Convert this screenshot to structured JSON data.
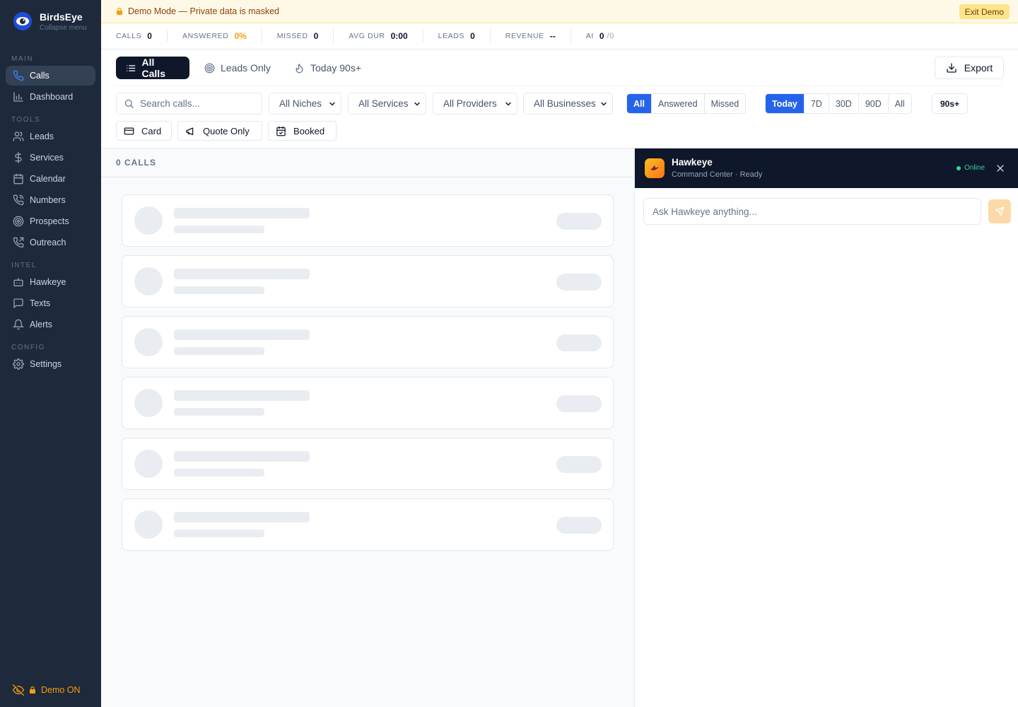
{
  "sidebar": {
    "brand": {
      "name": "BirdsEye",
      "sub": "Collapse menu"
    },
    "sections": {
      "main": "MAIN",
      "tools": "TOOLS",
      "intel": "INTEL",
      "config": "CONFIG"
    },
    "items": [
      {
        "label": "Calls",
        "icon": "phone-icon",
        "active": true
      },
      {
        "label": "Dashboard",
        "icon": "bar-chart-icon"
      },
      {
        "label": "Leads",
        "icon": "users-icon"
      },
      {
        "label": "Services",
        "icon": "dollar-icon"
      },
      {
        "label": "Calendar",
        "icon": "calendar-icon"
      },
      {
        "label": "Numbers",
        "icon": "phone-call-icon"
      },
      {
        "label": "Prospects",
        "icon": "target-icon"
      },
      {
        "label": "Outreach",
        "icon": "phone-outgoing-icon"
      },
      {
        "label": "Hawkeye",
        "icon": "bot-icon"
      },
      {
        "label": "Texts",
        "icon": "message-icon"
      },
      {
        "label": "Alerts",
        "icon": "bell-icon"
      },
      {
        "label": "Settings",
        "icon": "gear-icon"
      }
    ],
    "demo_toggle": "Demo ON"
  },
  "banner": {
    "text": "Demo Mode — Private data is masked",
    "exit_label": "Exit Demo"
  },
  "stats": [
    {
      "label": "CALLS",
      "value": "0"
    },
    {
      "label": "ANSWERED",
      "value": "0%"
    },
    {
      "label": "MISSED",
      "value": "0"
    },
    {
      "label": "AVG DUR",
      "value": "0:00"
    },
    {
      "label": "LEADS",
      "value": "0"
    },
    {
      "label": "REVENUE",
      "value": "--"
    },
    {
      "label": "AI",
      "value": "0",
      "suffix": "/0"
    }
  ],
  "view_tabs": [
    {
      "label": "All Calls",
      "icon": "list-icon",
      "active": true
    },
    {
      "label": "Leads Only",
      "icon": "target-icon"
    },
    {
      "label": "Today 90s+",
      "icon": "flame-icon"
    }
  ],
  "export_label": "Export",
  "search": {
    "placeholder": "Search calls..."
  },
  "filters": {
    "niches": "All Niches",
    "services": "All Services",
    "providers": "All Providers",
    "businesses": "All Businesses"
  },
  "status_seg": {
    "options": [
      "All",
      "Answered",
      "Missed"
    ],
    "selected": "All"
  },
  "range_seg": {
    "options": [
      "Today",
      "7D",
      "30D",
      "90D",
      "All"
    ],
    "selected": "Today"
  },
  "duration_chip": "90s+",
  "tags": [
    "Card",
    "Quote Only",
    "Booked"
  ],
  "list": {
    "count_label": "0 CALLS",
    "skeleton_rows": 6
  },
  "hawkeye": {
    "name": "Hawkeye",
    "subtitle": "Command Center · Ready",
    "status": "Online",
    "input_placeholder": "Ask Hawkeye anything..."
  },
  "colors": {
    "accent": "#2563eb",
    "sidebar": "#1e293b",
    "demo": "#f59e0b",
    "online": "#34d399"
  }
}
